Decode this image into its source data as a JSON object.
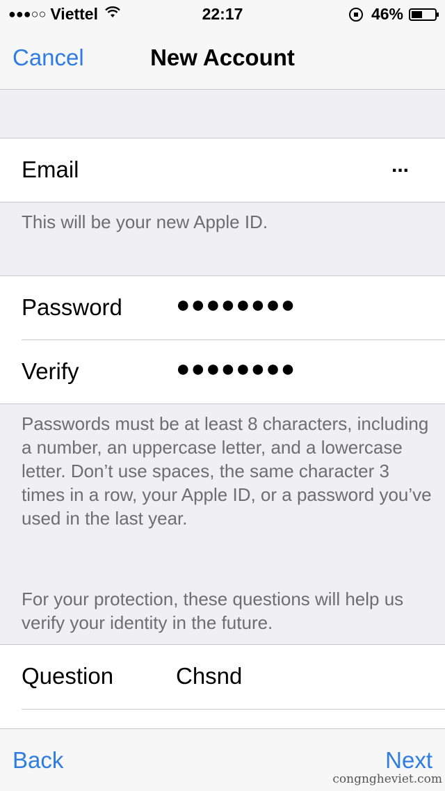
{
  "status_bar": {
    "signal_dots": "●●●○○",
    "carrier": "Viettel",
    "time": "22:17",
    "battery_percent": "46%",
    "battery_level": 0.46
  },
  "nav": {
    "cancel_label": "Cancel",
    "title": "New Account"
  },
  "email_section": {
    "label": "Email",
    "value": "...",
    "footnote": "This will be your new Apple ID."
  },
  "password_section": {
    "password_label": "Password",
    "password_value": "●●●●●●●●",
    "verify_label": "Verify",
    "verify_value": "●●●●●●●●",
    "footnote": "Passwords must be at least 8 characters, including a number, an uppercase letter, and a lowercase letter. Don’t use spaces, the same character 3 times in a row, your Apple ID, or a password you’ve used in the last year."
  },
  "questions_section": {
    "header_note": "For your protection, these questions will help us verify your identity in the future.",
    "question_label": "Question",
    "question_value": "Chsnd"
  },
  "toolbar": {
    "back_label": "Back",
    "next_label": "Next"
  },
  "watermark": "congngheviet.com",
  "colors": {
    "accent": "#2f7de1",
    "background": "#efeff4",
    "footnote_text": "#6d6d72"
  }
}
